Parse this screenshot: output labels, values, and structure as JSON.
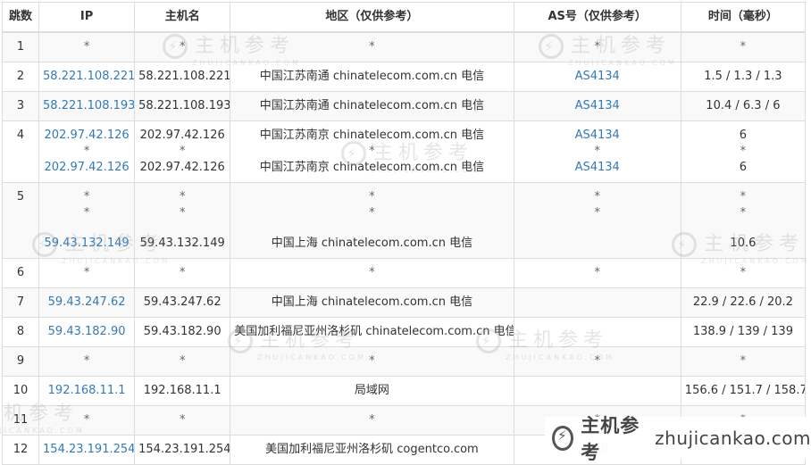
{
  "table": {
    "headers": {
      "hop": "跳数",
      "ip": "IP",
      "hostname": "主机名",
      "region": "地区（仅供参考）",
      "as": "AS号（仅供参考）",
      "time": "时间（毫秒）"
    },
    "rows": [
      {
        "hop": "1",
        "ip": [
          "*"
        ],
        "hostname": [
          "*"
        ],
        "region": [
          "*"
        ],
        "as": [
          "*"
        ],
        "time": [
          "*"
        ]
      },
      {
        "hop": "2",
        "ip": [
          "58.221.108.221"
        ],
        "hostname": [
          "58.221.108.221"
        ],
        "region": [
          "中国江苏南通 chinatelecom.com.cn 电信"
        ],
        "as": [
          "AS4134"
        ],
        "time": [
          "1.5 / 1.3 / 1.3"
        ]
      },
      {
        "hop": "3",
        "ip": [
          "58.221.108.193"
        ],
        "hostname": [
          "58.221.108.193"
        ],
        "region": [
          "中国江苏南通 chinatelecom.com.cn 电信"
        ],
        "as": [
          "AS4134"
        ],
        "time": [
          "10.4 / 6.3 / 6"
        ]
      },
      {
        "hop": "4",
        "ip": [
          "202.97.42.126",
          "*",
          "202.97.42.126"
        ],
        "hostname": [
          "202.97.42.126",
          "*",
          "202.97.42.126"
        ],
        "region": [
          "中国江苏南京 chinatelecom.com.cn 电信",
          "*",
          "中国江苏南京 chinatelecom.com.cn 电信"
        ],
        "as": [
          "AS4134",
          "*",
          "AS4134"
        ],
        "time": [
          "6",
          "*",
          "6"
        ]
      },
      {
        "hop": "5",
        "ip": [
          "*",
          "*",
          "59.43.132.149"
        ],
        "hostname": [
          "*",
          "*",
          "59.43.132.149"
        ],
        "region": [
          "*",
          "*",
          "中国上海 chinatelecom.com.cn 电信"
        ],
        "as": [
          "*",
          "*",
          ""
        ],
        "time": [
          "*",
          "*",
          "10.6"
        ]
      },
      {
        "hop": "6",
        "ip": [
          "*"
        ],
        "hostname": [
          "*"
        ],
        "region": [
          "*"
        ],
        "as": [
          "*"
        ],
        "time": [
          "*"
        ]
      },
      {
        "hop": "7",
        "ip": [
          "59.43.247.62"
        ],
        "hostname": [
          "59.43.247.62"
        ],
        "region": [
          "中国上海 chinatelecom.com.cn 电信"
        ],
        "as": [
          ""
        ],
        "time": [
          "22.9 / 22.6 / 20.2"
        ]
      },
      {
        "hop": "8",
        "ip": [
          "59.43.182.90"
        ],
        "hostname": [
          "59.43.182.90"
        ],
        "region": [
          "美国加利福尼亚州洛杉矶 chinatelecom.com.cn 电信"
        ],
        "as": [
          ""
        ],
        "time": [
          "138.9 / 139 / 139"
        ]
      },
      {
        "hop": "9",
        "ip": [
          "*"
        ],
        "hostname": [
          "*"
        ],
        "region": [
          "*"
        ],
        "as": [
          "*"
        ],
        "time": [
          "*"
        ]
      },
      {
        "hop": "10",
        "ip": [
          "192.168.11.1"
        ],
        "hostname": [
          "192.168.11.1"
        ],
        "region": [
          "局域网"
        ],
        "as": [
          ""
        ],
        "time": [
          "156.6 / 151.7 / 158.7"
        ]
      },
      {
        "hop": "11",
        "ip": [
          "*"
        ],
        "hostname": [
          "*"
        ],
        "region": [
          "*"
        ],
        "as": [
          "*"
        ],
        "time": [
          "*"
        ]
      },
      {
        "hop": "12",
        "ip": [
          "154.23.191.254"
        ],
        "hostname": [
          "154.23.191.254"
        ],
        "region": [
          "美国加利福尼亚州洛杉矶 cogentco.com"
        ],
        "as": [
          "AS8"
        ],
        "time": [
          ""
        ]
      }
    ]
  },
  "watermark": {
    "cn": "主机参考",
    "en": "ZHUJICANKAO.COM",
    "icon": "lightning-circle-icon"
  },
  "brand": {
    "cn": "主机参考",
    "url": "zhujicankao.com",
    "icon": "lightning-circle-icon"
  },
  "colors": {
    "link": "#337ab7",
    "text": "#333333",
    "border": "#dddddd",
    "stripe": "#f9f9f9"
  }
}
